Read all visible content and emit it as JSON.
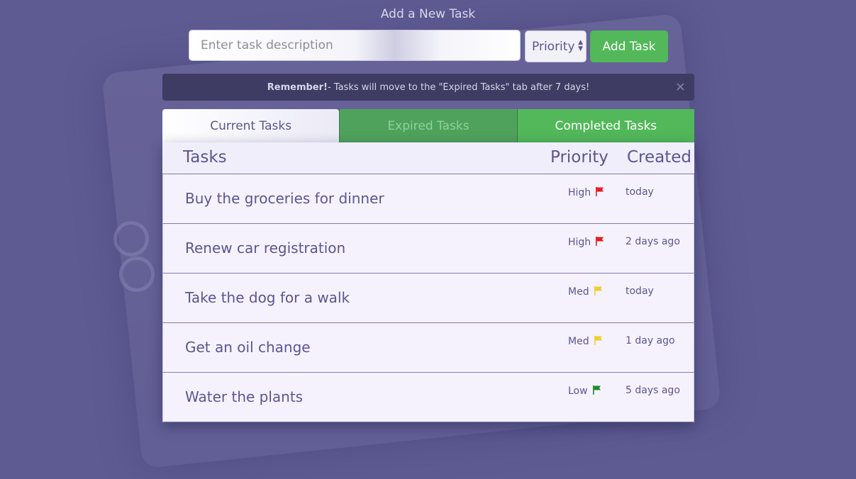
{
  "form": {
    "heading": "Add a New Task",
    "task_placeholder": "Enter task description",
    "priority_label": "Priority",
    "add_button": "Add Task"
  },
  "alert": {
    "strong": "Remember!",
    "message": " - Tasks will move to the \"Expired Tasks\" tab after 7 days!",
    "close": "×"
  },
  "tabs": [
    {
      "label": "Current Tasks",
      "active": true
    },
    {
      "label": "Expired Tasks",
      "active": false
    },
    {
      "label": "Completed Tasks",
      "active": false
    }
  ],
  "table": {
    "headers": {
      "tasks": "Tasks",
      "priority": "Priority",
      "created": "Created"
    },
    "rows": [
      {
        "description": "Buy the groceries for dinner",
        "priority": "High",
        "flag_color": "#e02020",
        "created": "today"
      },
      {
        "description": "Renew car registration",
        "priority": "High",
        "flag_color": "#e02020",
        "created": "2 days ago"
      },
      {
        "description": "Take the dog for a walk",
        "priority": "Med",
        "flag_color": "#f3cc2e",
        "created": "today"
      },
      {
        "description": "Get an oil change",
        "priority": "Med",
        "flag_color": "#f3cc2e",
        "created": "1 day ago"
      },
      {
        "description": "Water the plants",
        "priority": "Low",
        "flag_color": "#1f8a2a",
        "created": "5 days ago"
      }
    ]
  },
  "colors": {
    "background": "#5e5b92",
    "accent_green": "#52b85a",
    "text": "#5a5690"
  }
}
